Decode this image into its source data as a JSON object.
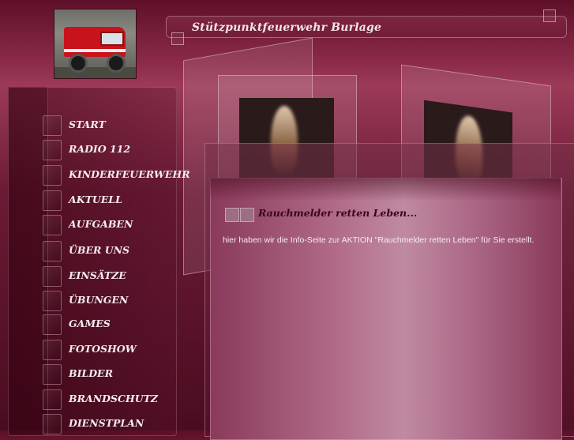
{
  "header": {
    "site_title": "Stützpunktfeuerwehr Burlage"
  },
  "logo": {
    "alt": "Feuerwehrfahrzeug"
  },
  "nav": {
    "items": [
      {
        "label": "START"
      },
      {
        "label": "RADIO 112"
      },
      {
        "label": "KINDERFEUERWEHR"
      },
      {
        "label": "AKTUELL"
      },
      {
        "label": "AUFGABEN"
      },
      {
        "label": "ÜBER UNS"
      },
      {
        "label": "EINSÄTZE"
      },
      {
        "label": "ÜBUNGEN"
      },
      {
        "label": "GAMES"
      },
      {
        "label": "FOTOSHOW"
      },
      {
        "label": "BILDER"
      },
      {
        "label": "BRANDSCHUTZ"
      },
      {
        "label": "DIENSTPLAN"
      }
    ]
  },
  "content": {
    "heading": "Rauchmelder retten Leben...",
    "text": "hier haben wir die Info-Seite zur AKTION \"Rauchmelder retten Leben\" für Sie erstellt."
  },
  "colors": {
    "background": "#6b1a34",
    "panel": "#b06a88",
    "heading_text": "#3a0616",
    "nav_text": "#f5ecef"
  }
}
